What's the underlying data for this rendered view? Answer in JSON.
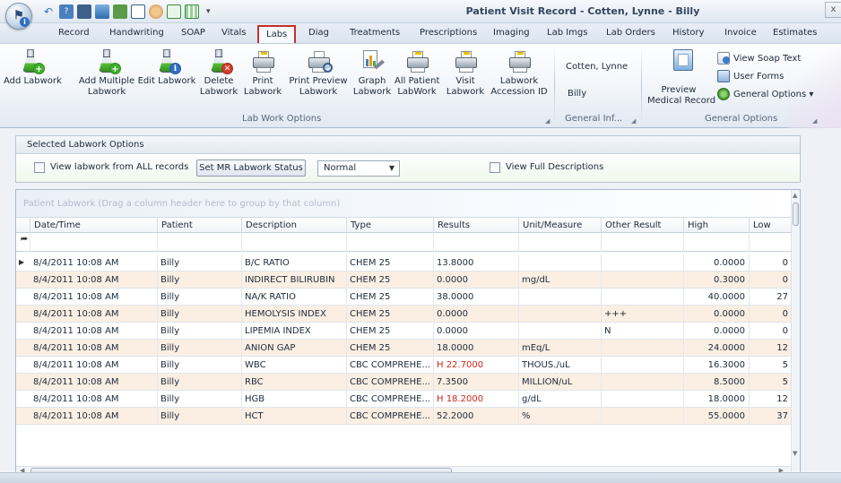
{
  "window": {
    "title": "Patient Visit Record - Cotten, Lynne  - Billy",
    "close_label": "x"
  },
  "tabs": [
    {
      "label": "Record"
    },
    {
      "label": "Handwriting"
    },
    {
      "label": "SOAP"
    },
    {
      "label": "Vitals"
    },
    {
      "label": "Labs"
    },
    {
      "label": "Diag"
    },
    {
      "label": "Treatments"
    },
    {
      "label": "Prescriptions"
    },
    {
      "label": "Imaging"
    },
    {
      "label": "Lab Imgs"
    },
    {
      "label": "Lab Orders"
    },
    {
      "label": "History"
    },
    {
      "label": "Invoice"
    },
    {
      "label": "Estimates"
    }
  ],
  "ribbon": {
    "buttons": [
      {
        "line1": "Add Labwork",
        "line2": "",
        "icon": "flask-add-icon"
      },
      {
        "line1": "Add Multiple",
        "line2": "Labwork",
        "icon": "flask-add-multiple-icon"
      },
      {
        "line1": "Edit Labwork",
        "line2": "",
        "icon": "flask-edit-icon"
      },
      {
        "line1": "Delete",
        "line2": "Labwork",
        "icon": "flask-delete-icon"
      },
      {
        "line1": "Print",
        "line2": "Labwork",
        "icon": "printer-icon"
      },
      {
        "line1": "Print Preview",
        "line2": "Labwork",
        "icon": "print-preview-icon"
      },
      {
        "line1": "Graph",
        "line2": "Labwork",
        "icon": "graph-icon"
      },
      {
        "line1": "All Patient",
        "line2": "LabWork",
        "icon": "printer-icon"
      },
      {
        "line1": "Visit",
        "line2": "Labwork",
        "icon": "printer-icon"
      },
      {
        "line1": "Labwork",
        "line2": "Accession ID",
        "icon": "printer-icon"
      }
    ],
    "group_lab": "Lab Work Options",
    "general_info": {
      "client": "Cotten, Lynne",
      "patient": "Billy",
      "label": "General Inf..."
    },
    "preview": {
      "line1": "Preview",
      "line2": "Medical Record"
    },
    "view_soap": "View Soap Text",
    "user_forms": "User Forms",
    "general_options_btn": "General Options ▾",
    "group_general": "General Options"
  },
  "options": {
    "title": "Selected Labwork Options",
    "view_all": "View labwork from ALL records",
    "set_status": "Set MR Labwork Status",
    "status_value": "Normal",
    "view_full": "View Full Descriptions"
  },
  "grid": {
    "group_hint": "Patient Labwork    (Drag a column header here to group by that column)",
    "columns": [
      "Date/Time",
      "Patient",
      "Description",
      "Type",
      "Results",
      "Unit/Measure",
      "Other Result",
      "High",
      "Low"
    ],
    "rows": [
      {
        "date": "8/4/2011 10:08 AM",
        "patient": "Billy",
        "desc": "B/C RATIO",
        "type": "CHEM 25",
        "result": "13.8000",
        "unit": "",
        "other": "",
        "high": "0.0000",
        "low": "0"
      },
      {
        "date": "8/4/2011 10:08 AM",
        "patient": "Billy",
        "desc": "INDIRECT BILIRUBIN",
        "type": "CHEM 25",
        "result": "0.0000",
        "unit": "mg/dL",
        "other": "",
        "high": "0.3000",
        "low": "0"
      },
      {
        "date": "8/4/2011 10:08 AM",
        "patient": "Billy",
        "desc": "NA/K RATIO",
        "type": "CHEM 25",
        "result": "38.0000",
        "unit": "",
        "other": "",
        "high": "40.0000",
        "low": "27"
      },
      {
        "date": "8/4/2011 10:08 AM",
        "patient": "Billy",
        "desc": "HEMOLYSIS INDEX",
        "type": "CHEM 25",
        "result": "0.0000",
        "unit": "",
        "other": "+++",
        "high": "0.0000",
        "low": "0"
      },
      {
        "date": "8/4/2011 10:08 AM",
        "patient": "Billy",
        "desc": "LIPEMIA INDEX",
        "type": "CHEM 25",
        "result": "0.0000",
        "unit": "",
        "other": "N",
        "high": "0.0000",
        "low": "0"
      },
      {
        "date": "8/4/2011 10:08 AM",
        "patient": "Billy",
        "desc": "ANION GAP",
        "type": "CHEM 25",
        "result": "18.0000",
        "unit": "mEq/L",
        "other": "",
        "high": "24.0000",
        "low": "12"
      },
      {
        "date": "8/4/2011 10:08 AM",
        "patient": "Billy",
        "desc": "WBC",
        "type": "CBC COMPREHE...",
        "result": "H 22.7000",
        "unit": "THOUS./uL",
        "other": "",
        "high": "16.3000",
        "low": "5"
      },
      {
        "date": "8/4/2011 10:08 AM",
        "patient": "Billy",
        "desc": "RBC",
        "type": "CBC COMPREHE...",
        "result": "7.3500",
        "unit": "MILLION/uL",
        "other": "",
        "high": "8.5000",
        "low": "5"
      },
      {
        "date": "8/4/2011 10:08 AM",
        "patient": "Billy",
        "desc": "HGB",
        "type": "CBC COMPREHE...",
        "result": "H 18.2000",
        "unit": "g/dL",
        "other": "",
        "high": "18.0000",
        "low": "12"
      },
      {
        "date": "8/4/2011 10:08 AM",
        "patient": "Billy",
        "desc": "HCT",
        "type": "CBC COMPREHE...",
        "result": "52.2000",
        "unit": "%",
        "other": "",
        "high": "55.0000",
        "low": "37"
      }
    ]
  }
}
